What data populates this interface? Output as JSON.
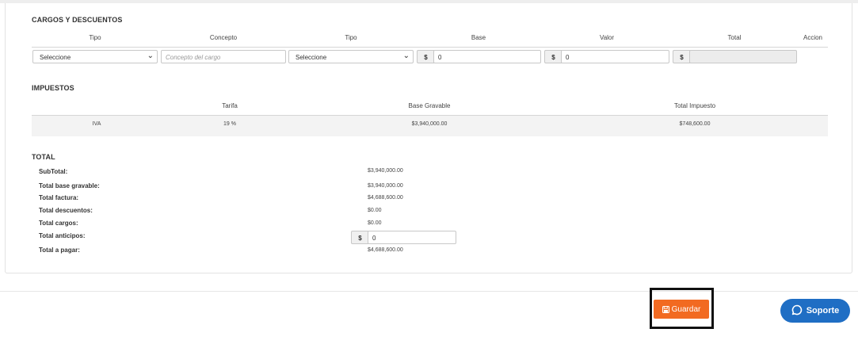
{
  "cargos": {
    "title": "CARGOS Y DESCUENTOS",
    "headers": {
      "tipo1": "Tipo",
      "concepto": "Concepto",
      "tipo2": "Tipo",
      "base": "Base",
      "valor": "Valor",
      "total": "Total",
      "accion": "Accion"
    },
    "row": {
      "tipo1_selected": "Seleccione",
      "concepto_placeholder": "Concepto del cargo",
      "tipo2_selected": "Seleccione",
      "currency": "$",
      "base_value": "0",
      "valor_value": "0",
      "total_value": ""
    }
  },
  "impuestos": {
    "title": "IMPUESTOS",
    "headers": {
      "tarifa": "Tarifa",
      "base_gravable": "Base Gravable",
      "total_impuesto": "Total Impuesto"
    },
    "rows": [
      {
        "name": "IVA",
        "tarifa": "19 %",
        "base_gravable": "$3,940,000.00",
        "total_impuesto": "$748,600.00"
      }
    ]
  },
  "total": {
    "title": "TOTAL",
    "items": [
      {
        "label": "SubTotal:",
        "value": "$3,940,000.00"
      },
      {
        "label": "Total base gravable:",
        "value": "$3,940,000.00"
      },
      {
        "label": "Total factura:",
        "value": "$4,688,600.00"
      },
      {
        "label": "Total descuentos:",
        "value": "$0.00"
      },
      {
        "label": "Total cargos:",
        "value": "$0.00"
      },
      {
        "label": "Total anticipos:",
        "currency": "$",
        "input_value": "0"
      },
      {
        "label": "Total a pagar:",
        "value": "$4,688,600.00"
      }
    ]
  },
  "footer": {
    "save_label": "Guardar",
    "support_label": "Soporte"
  },
  "colors": {
    "save_button": "#f26a21",
    "support_button": "#1f6ec4",
    "highlight_border": "#111111"
  },
  "icons": {
    "save": "floppy-disk-icon",
    "support": "chat-bubble-icon",
    "select_arrow": "chevron-down-icon"
  }
}
